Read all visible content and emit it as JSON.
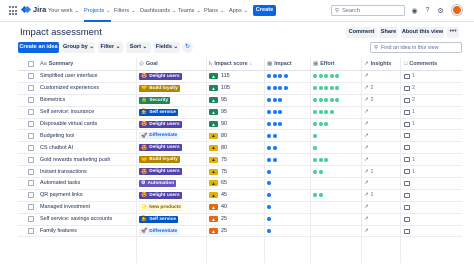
{
  "nav": {
    "logo": "Jira",
    "items": [
      "Your work",
      "Projects",
      "Filters",
      "Dashboards",
      "Teams",
      "Plans",
      "Apps"
    ],
    "active_index": 1,
    "create": "Create",
    "search_placeholder": "Search",
    "icons": [
      "notification-icon",
      "help-icon",
      "settings-icon",
      "avatar"
    ]
  },
  "header": {
    "title": "Impact assessment",
    "buttons": [
      "Comment",
      "Share",
      "About this view"
    ],
    "more": "•••"
  },
  "toolbar": {
    "create_idea": "Create an idea",
    "group_by": "Group by",
    "filter": "Filter",
    "sort": "Sort",
    "fields": "Fields",
    "search_placeholder": "Find an idea in this view"
  },
  "table": {
    "columns": {
      "summary": "Summary",
      "goal": "Goal",
      "impact_score": "Impact score",
      "impact": "Impact",
      "effort": "Effort",
      "insights": "Insights",
      "comments": "Comments"
    },
    "rows": [
      {
        "summary": "Simplified user interface",
        "goal": "Delight users",
        "goal_key": "delight",
        "goal_emoji": "😍",
        "score": "115",
        "score_key": "green",
        "impact": 4,
        "effort": 5,
        "insights": "",
        "comments": "1"
      },
      {
        "summary": "Customized experiences",
        "goal": "Build loyalty",
        "goal_key": "loyalty",
        "goal_emoji": "🤝",
        "score": "105",
        "score_key": "green",
        "impact": 4,
        "effort": 5,
        "insights": "2",
        "comments": "2"
      },
      {
        "summary": "Biometrics",
        "goal": "Security",
        "goal_key": "security",
        "goal_emoji": "🔒",
        "score": "95",
        "score_key": "green",
        "impact": 3,
        "effort": 5,
        "insights": "2",
        "comments": "2"
      },
      {
        "summary": "Self service: insurance",
        "goal": "Self service",
        "goal_key": "selfservice",
        "goal_emoji": "💁",
        "score": "95",
        "score_key": "green",
        "impact": 3,
        "effort": 4,
        "insights": "",
        "comments": "1"
      },
      {
        "summary": "Disposable virtual cards",
        "goal": "Delight users",
        "goal_key": "delight",
        "goal_emoji": "😍",
        "score": "90",
        "score_key": "green",
        "impact": 3,
        "effort": 3,
        "insights": "",
        "comments": "1"
      },
      {
        "summary": "Budgeting tool",
        "goal": "Differentiate",
        "goal_key": "differentiate",
        "goal_emoji": "🚀",
        "score": "80",
        "score_key": "yellow",
        "impact": 2,
        "effort": 1,
        "insights": "",
        "comments": ""
      },
      {
        "summary": "CS chatbot AI",
        "goal": "Delight users",
        "goal_key": "delight",
        "goal_emoji": "😍",
        "score": "80",
        "score_key": "yellow",
        "impact": 2,
        "effort": 1,
        "insights": "",
        "comments": ""
      },
      {
        "summary": "Gold rewards marketing push",
        "goal": "Build loyalty",
        "goal_key": "loyalty",
        "goal_emoji": "🤝",
        "score": "75",
        "score_key": "yellow",
        "impact": 2,
        "effort": 3,
        "insights": "",
        "comments": "1"
      },
      {
        "summary": "Instant transactions",
        "goal": "Delight users",
        "goal_key": "delight",
        "goal_emoji": "😍",
        "score": "75",
        "score_key": "yellow",
        "impact": 1,
        "effort": 2,
        "insights": "1",
        "comments": "1"
      },
      {
        "summary": "Automated tasks",
        "goal": "Automation",
        "goal_key": "automation",
        "goal_emoji": "⚙",
        "score": "65",
        "score_key": "yellow",
        "impact": 1,
        "effort": 0,
        "insights": "",
        "comments": ""
      },
      {
        "summary": "QR payment links",
        "goal": "Delight users",
        "goal_key": "delight",
        "goal_emoji": "😍",
        "score": "45",
        "score_key": "yellow",
        "impact": 1,
        "effort": 2,
        "insights": "1",
        "comments": ""
      },
      {
        "summary": "Managed investment",
        "goal": "New products",
        "goal_key": "newproducts",
        "goal_emoji": "✨",
        "score": "40",
        "score_key": "orange",
        "impact": 1,
        "effort": 0,
        "insights": "",
        "comments": ""
      },
      {
        "summary": "Self service: savings accounts",
        "goal": "Self service",
        "goal_key": "selfservice",
        "goal_emoji": "💁",
        "score": "25",
        "score_key": "orange",
        "impact": 1,
        "effort": 0,
        "insights": "",
        "comments": ""
      },
      {
        "summary": "Family features",
        "goal": "Differentiate",
        "goal_key": "differentiate",
        "goal_emoji": "🚀",
        "score": "25",
        "score_key": "orange",
        "impact": 1,
        "effort": 0,
        "insights": "",
        "comments": ""
      }
    ]
  },
  "colors": {
    "brand": "#0c66e4",
    "impact_dot": "#1d7afc",
    "effort_dot": "#4bce97"
  }
}
